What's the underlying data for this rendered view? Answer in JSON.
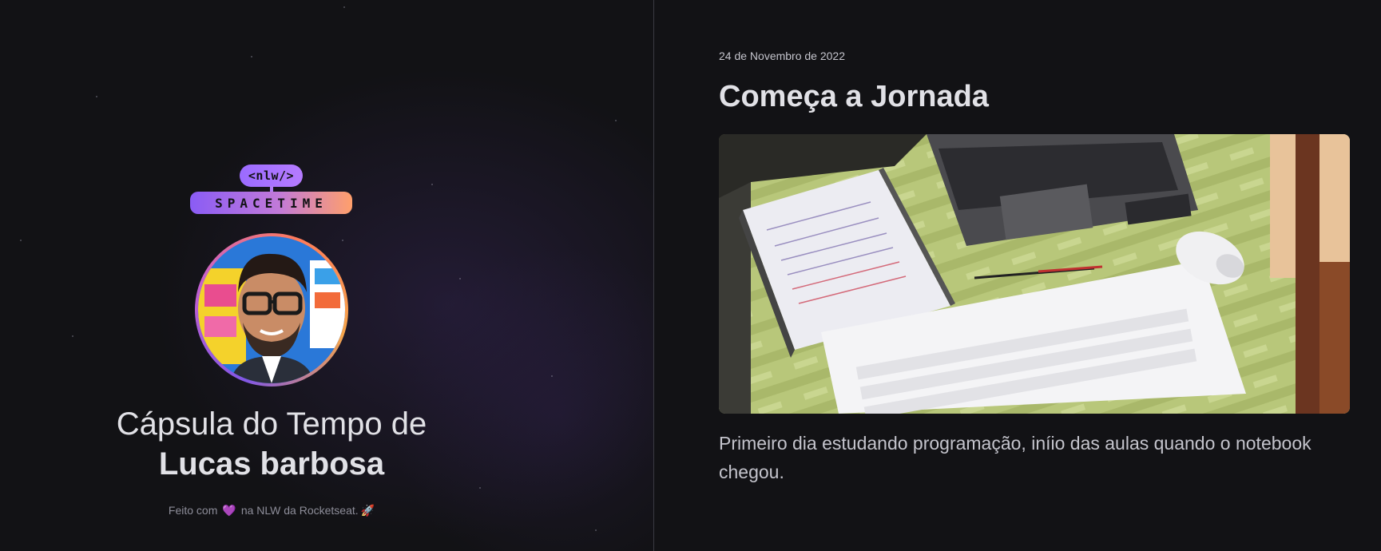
{
  "left": {
    "logo": {
      "top_text": "<nlw/>",
      "bottom_text": "SPACETIME"
    },
    "avatar_icon": "user-photo",
    "title_line1": "Cápsula do Tempo de",
    "title_line2": "Lucas barbosa",
    "footer": {
      "prefix": "Feito com",
      "heart": "💜",
      "suffix": "na NLW da Rocketseat.",
      "rocket": "🚀"
    }
  },
  "memory": {
    "date": "24 de Novembro de 2022",
    "title": "Começa a Jornada",
    "image_icon": "desk-photo",
    "text": "Primeiro dia estudando programação, iníio das aulas quando o notebook chegou."
  },
  "colors": {
    "background": "#121215",
    "panel_border": "#3a3a42",
    "text_primary": "#e1e1e6",
    "text_secondary": "#c4c4cc",
    "brand_purple": "#8257e5",
    "brand_orange": "#ff9f6b"
  }
}
